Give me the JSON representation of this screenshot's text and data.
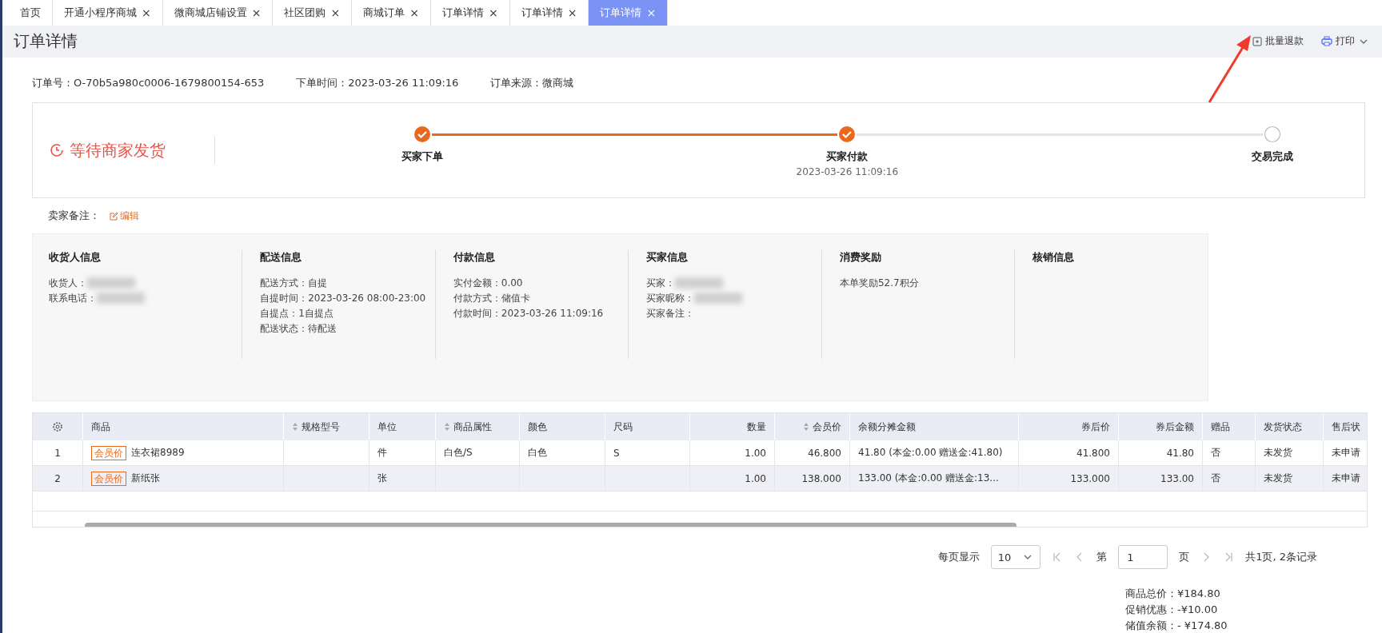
{
  "tabs": [
    {
      "label": "首页",
      "closable": false,
      "selected": false
    },
    {
      "label": "开通小程序商城",
      "closable": true,
      "selected": false
    },
    {
      "label": "微商城店铺设置",
      "closable": true,
      "selected": false
    },
    {
      "label": "社区团购",
      "closable": true,
      "selected": false
    },
    {
      "label": "商城订单",
      "closable": true,
      "selected": false
    },
    {
      "label": "订单详情",
      "closable": true,
      "selected": false
    },
    {
      "label": "订单详情",
      "closable": true,
      "selected": false
    },
    {
      "label": "订单详情",
      "closable": true,
      "selected": true
    }
  ],
  "close_glyph": "×",
  "page_title": "订单详情",
  "actions": [
    {
      "kind": "refund",
      "label": "批量退款"
    },
    {
      "kind": "print",
      "label": "打印"
    }
  ],
  "order_meta": [
    {
      "label": "订单号：",
      "value": "O-70b5a980c0006-1679800154-653"
    },
    {
      "label": "下单时间：",
      "value": "2023-03-26 11:09:16"
    },
    {
      "label": "订单来源：",
      "value": "微商城"
    }
  ],
  "status": "等待商家发货",
  "steps": [
    {
      "label": "买家下单",
      "done": true
    },
    {
      "label": "买家付款",
      "done": true,
      "time": "2023-03-26 11:09:16"
    },
    {
      "label": "交易完成",
      "done": false
    }
  ],
  "seller_note": {
    "label": "卖家备注：",
    "edit": "编辑"
  },
  "info_sections": [
    {
      "title": "收货人信息",
      "fields": [
        {
          "label": "收货人：",
          "redacted": true
        },
        {
          "label": "联系电话：",
          "redacted": true
        }
      ]
    },
    {
      "title": "配送信息",
      "fields": [
        {
          "label": "配送方式：",
          "value": "自提"
        },
        {
          "label": "自提时间：",
          "value": "2023-03-26 08:00-23:00"
        },
        {
          "label": "自提点：",
          "value": "1自提点"
        },
        {
          "label": "配送状态：",
          "value": "待配送"
        }
      ]
    },
    {
      "title": "付款信息",
      "fields": [
        {
          "label": "实付金额：",
          "value": "0.00"
        },
        {
          "label": "付款方式：",
          "value": "储值卡"
        },
        {
          "label": "付款时间：",
          "value": "2023-03-26 11:09:16"
        }
      ]
    },
    {
      "title": "买家信息",
      "fields": [
        {
          "label": "买家：",
          "redacted": true
        },
        {
          "label": "买家昵称：",
          "redacted": true
        },
        {
          "label": "买家备注：",
          "redacted": false
        }
      ]
    },
    {
      "title": "消费奖励",
      "fields": [
        {
          "value": "本单奖励52.7积分"
        }
      ]
    },
    {
      "title": "核销信息"
    }
  ],
  "table": {
    "columns": [
      {
        "label": "商品",
        "sortable": false
      },
      {
        "label": "规格型号",
        "sortable": true
      },
      {
        "label": "单位",
        "sortable": false
      },
      {
        "label": "商品属性",
        "sortable": true
      },
      {
        "label": "颜色",
        "sortable": false
      },
      {
        "label": "尺码",
        "sortable": false
      },
      {
        "label": "数量",
        "sortable": false
      },
      {
        "label": "会员价",
        "sortable": true
      },
      {
        "label": "余额分摊金额",
        "sortable": false
      },
      {
        "label": "券后价",
        "sortable": false
      },
      {
        "label": "券后金额",
        "sortable": false
      },
      {
        "label": "赠品",
        "sortable": false
      },
      {
        "label": "发货状态",
        "sortable": false
      },
      {
        "label": "售后状",
        "sortable": false
      }
    ],
    "rows": [
      {
        "index": "1",
        "selected": false,
        "tag": "会员价",
        "cells": [
          "连衣裙8989",
          "",
          "件",
          "白色/S",
          "白色",
          "S",
          "1.00",
          "46.800",
          "41.80 (本金:0.00 赠送金:41.80)",
          "41.800",
          "41.80",
          "否",
          "未发货",
          "未申请"
        ]
      },
      {
        "index": "2",
        "selected": true,
        "tag": "会员价",
        "cells": [
          "新纸张",
          "",
          "张",
          "",
          "",
          "",
          "1.00",
          "138.000",
          "133.00 (本金:0.00 赠送金:13...",
          "133.000",
          "133.00",
          "否",
          "未发货",
          "未申请"
        ]
      }
    ]
  },
  "pagination": {
    "page_size_label": "每页显示",
    "page_size": "10",
    "page_prefix": "第",
    "page": "1",
    "page_suffix": "页",
    "summary": "共1页, 2条记录"
  },
  "totals": [
    {
      "label": "商品总价：",
      "value": "¥184.80"
    },
    {
      "label": "促销优惠：",
      "value": "-¥10.00"
    },
    {
      "label": "储值余额：",
      "value": "- ¥174.80"
    }
  ]
}
